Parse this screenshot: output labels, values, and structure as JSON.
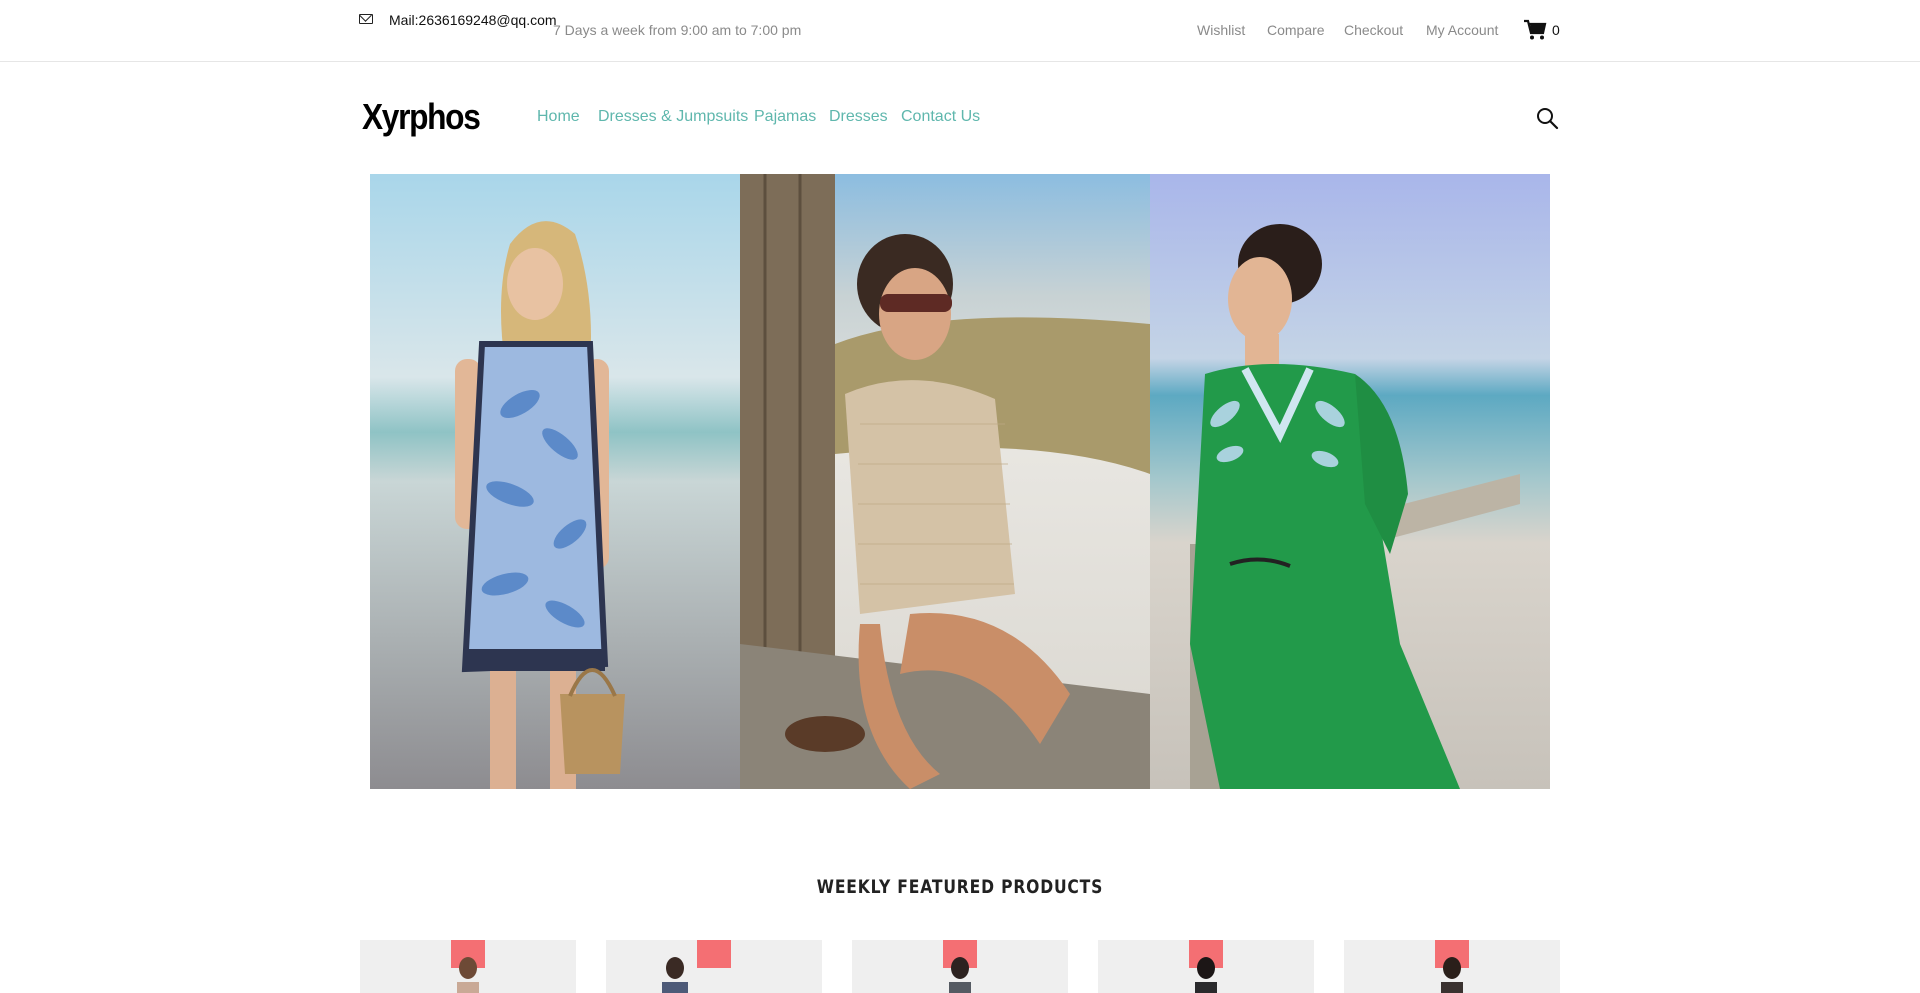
{
  "topbar": {
    "mail_icon": "envelope-icon",
    "mail": "Mail:2636169248@qq.com",
    "hours": "7 Days a week from 9:00 am to 7:00 pm",
    "links": [
      "Wishlist",
      "Compare",
      "Checkout",
      "My Account"
    ],
    "cart_icon": "shopping-cart-icon",
    "cart_count": "0"
  },
  "header": {
    "logo": "Xyrphos",
    "nav": [
      "Home",
      "Dresses & Jumpsuits",
      "Pajamas",
      "Dresses",
      "Contact Us"
    ],
    "search_icon": "search-icon",
    "accent_color": "#5fb7ad"
  },
  "hero": {
    "panels": [
      {
        "name": "hero-panel-blue-print-dress"
      },
      {
        "name": "hero-panel-knit-top"
      },
      {
        "name": "hero-panel-green-embroidered-dress"
      }
    ]
  },
  "featured": {
    "title": "WEEKLY FEATURED PRODUCTS",
    "badge_color": "#f46f73",
    "products": [
      {},
      {},
      {},
      {},
      {}
    ]
  }
}
